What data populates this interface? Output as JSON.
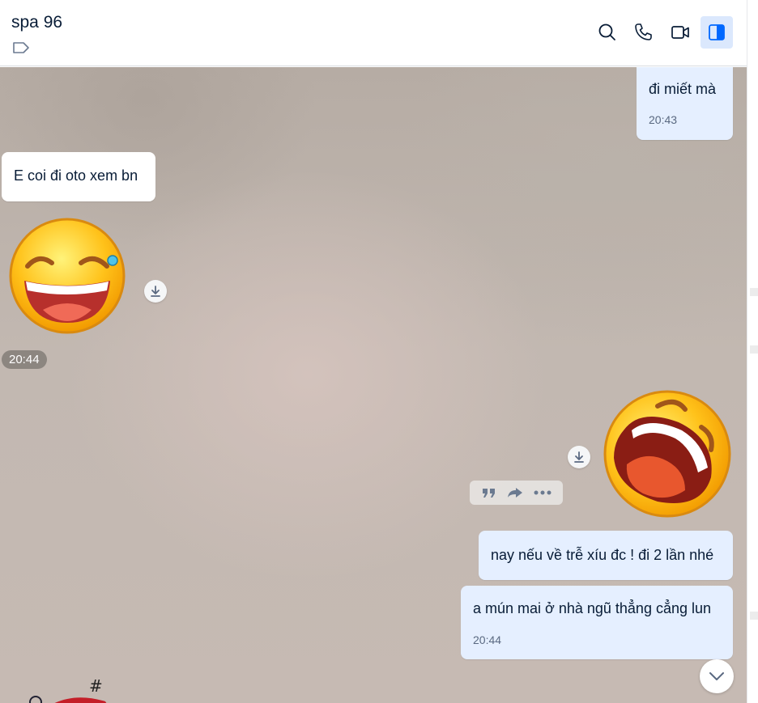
{
  "header": {
    "title": "spa 96",
    "icons": [
      "tag-icon",
      "search-icon",
      "phone-icon",
      "video-call-icon",
      "sidebar-toggle-icon"
    ]
  },
  "colors": {
    "accent": "#0068ff",
    "my_bubble": "#e5efff",
    "other_bubble": "#ffffff",
    "text": "#081c36"
  },
  "messages": [
    {
      "side": "me",
      "text": "đi miết mà",
      "time": "20:43"
    },
    {
      "side": "other",
      "text": "E coi đi oto xem bn"
    },
    {
      "side": "other",
      "type": "sticker",
      "sticker": "laughing-tears-emoji",
      "time": "20:44"
    },
    {
      "side": "me",
      "type": "sticker",
      "sticker": "rolling-laughing-emoji"
    },
    {
      "side": "me",
      "text": "nay nếu về trễ xíu đc ! đi 2 lần nhé"
    },
    {
      "side": "me",
      "text": "a mún mai ở nhà ngũ thẳng cẳng lun",
      "time": "20:44"
    }
  ],
  "message_actions": [
    "quote-icon",
    "forward-icon",
    "more-icon"
  ],
  "partial_sticker_text": "#"
}
